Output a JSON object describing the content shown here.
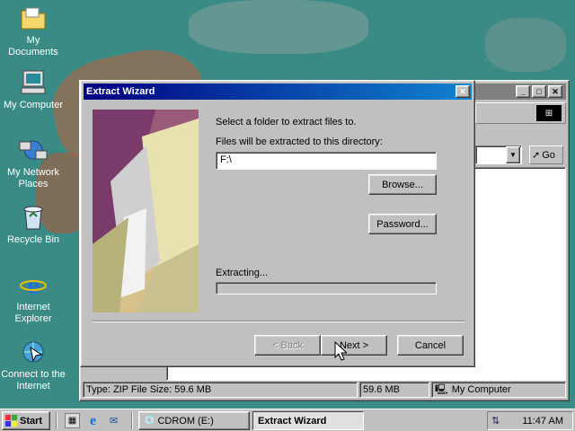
{
  "desktop": {
    "icons": [
      {
        "label": "My Documents"
      },
      {
        "label": "My Computer"
      },
      {
        "label": "My Network Places"
      },
      {
        "label": "Recycle Bin"
      },
      {
        "label": "Internet Explorer"
      },
      {
        "label": "Connect to the Internet"
      }
    ]
  },
  "explorer": {
    "go_label": "Go",
    "status": {
      "type_size": "Type: ZIP File Size: 59.6 MB",
      "size": "59.6 MB",
      "location": "My Computer"
    }
  },
  "wizard": {
    "title": "Extract Wizard",
    "instruction": "Select a folder to extract files to.",
    "dir_label": "Files will be extracted to this directory:",
    "dir_value": "F:\\",
    "browse_label": "Browse...",
    "password_label": "Password...",
    "extracting_label": "Extracting...",
    "progress": 0,
    "back_label": "< Back",
    "next_label": "Next >",
    "cancel_label": "Cancel"
  },
  "taskbar": {
    "start_label": "Start",
    "tasks": [
      {
        "label": "CDROM (E:)"
      },
      {
        "label": "Extract Wizard"
      }
    ],
    "clock": "11:47 AM"
  },
  "colors": {
    "desktop": "#3a8a86",
    "title_active": "#000080",
    "title_inactive": "#808080",
    "face": "#c0c0c0"
  }
}
